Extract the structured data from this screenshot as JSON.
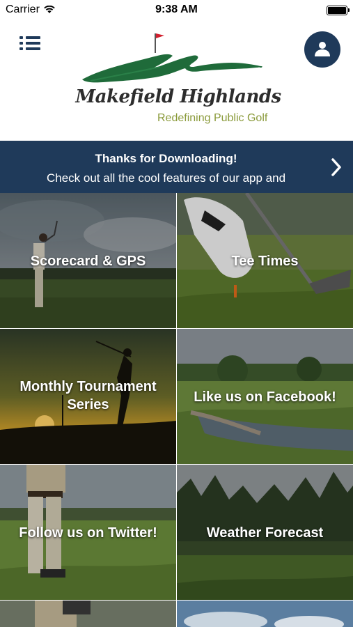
{
  "status_bar": {
    "carrier": "Carrier",
    "time": "9:38 AM"
  },
  "header": {
    "logo_title": "Makefield Highlands",
    "logo_subtitle": "Redefining Public Golf"
  },
  "banner": {
    "title": "Thanks for Downloading!",
    "text": "Check out all the cool features of our app and"
  },
  "tiles": [
    {
      "label": "Scorecard & GPS"
    },
    {
      "label": "Tee Times"
    },
    {
      "label": "Monthly Tournament Series"
    },
    {
      "label": "Like us on Facebook!"
    },
    {
      "label": "Follow us on Twitter!"
    },
    {
      "label": "Weather Forecast"
    }
  ],
  "colors": {
    "navy": "#1f3a5a",
    "logo_green": "#1f6b3a",
    "flag_red": "#d21f2e",
    "subtitle_green": "#8a9a3a"
  }
}
